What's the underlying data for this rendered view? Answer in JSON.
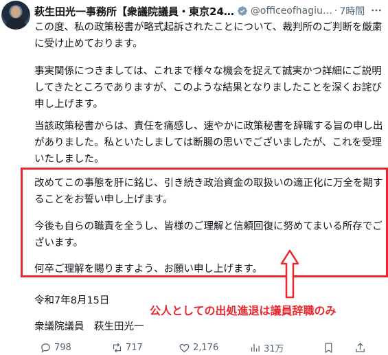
{
  "post": {
    "author_name": "萩生田光一事務所【衆議院議員・東京24…",
    "handle": "@officeofhagiu…",
    "separator": "·",
    "time": "7時間",
    "paragraphs": [
      "この度、私の政策秘書が略式起訴されたことについて、裁判所のご判断を厳粛に受け止めております。",
      "事実関係につきましては、これまで様々な機会を捉えて誠実かつ詳細にご説明してきたところでありますが、このような結果となりましたことを深くお詫び申し上げます。",
      "当該政策秘書からは、責任を痛感し、速やかに政策秘書を辞職する旨の申し出がありました。私といたしましては断腸の思いでございましたが、これを受理いたしました。",
      "改めてこの事態を肝に銘じ、引き続き政治資金の取扱いの適正化に万全を期することをお誓い申し上げます。",
      "今後も自らの職責を全うし、皆様のご理解と信頼回復に努めてまいる所存でございます。",
      "何卒ご理解を賜りますよう、お願い申し上げます。"
    ],
    "date": "令和7年8月15日",
    "signature": "衆議院議員　萩生田光一"
  },
  "annotation": {
    "text": "公人としての出処進退は議員辞職のみ",
    "color": "#e8262d"
  },
  "actions": {
    "replies": "798",
    "reposts": "717",
    "likes": "2,176",
    "views": "31万"
  },
  "icons": [
    "verified-icon",
    "more-icon",
    "reply-icon",
    "repost-icon",
    "like-icon",
    "views-icon",
    "bookmark-icon",
    "share-icon"
  ],
  "colors": {
    "text": "#0f1419",
    "muted": "#536471",
    "verified": "#829aab"
  }
}
